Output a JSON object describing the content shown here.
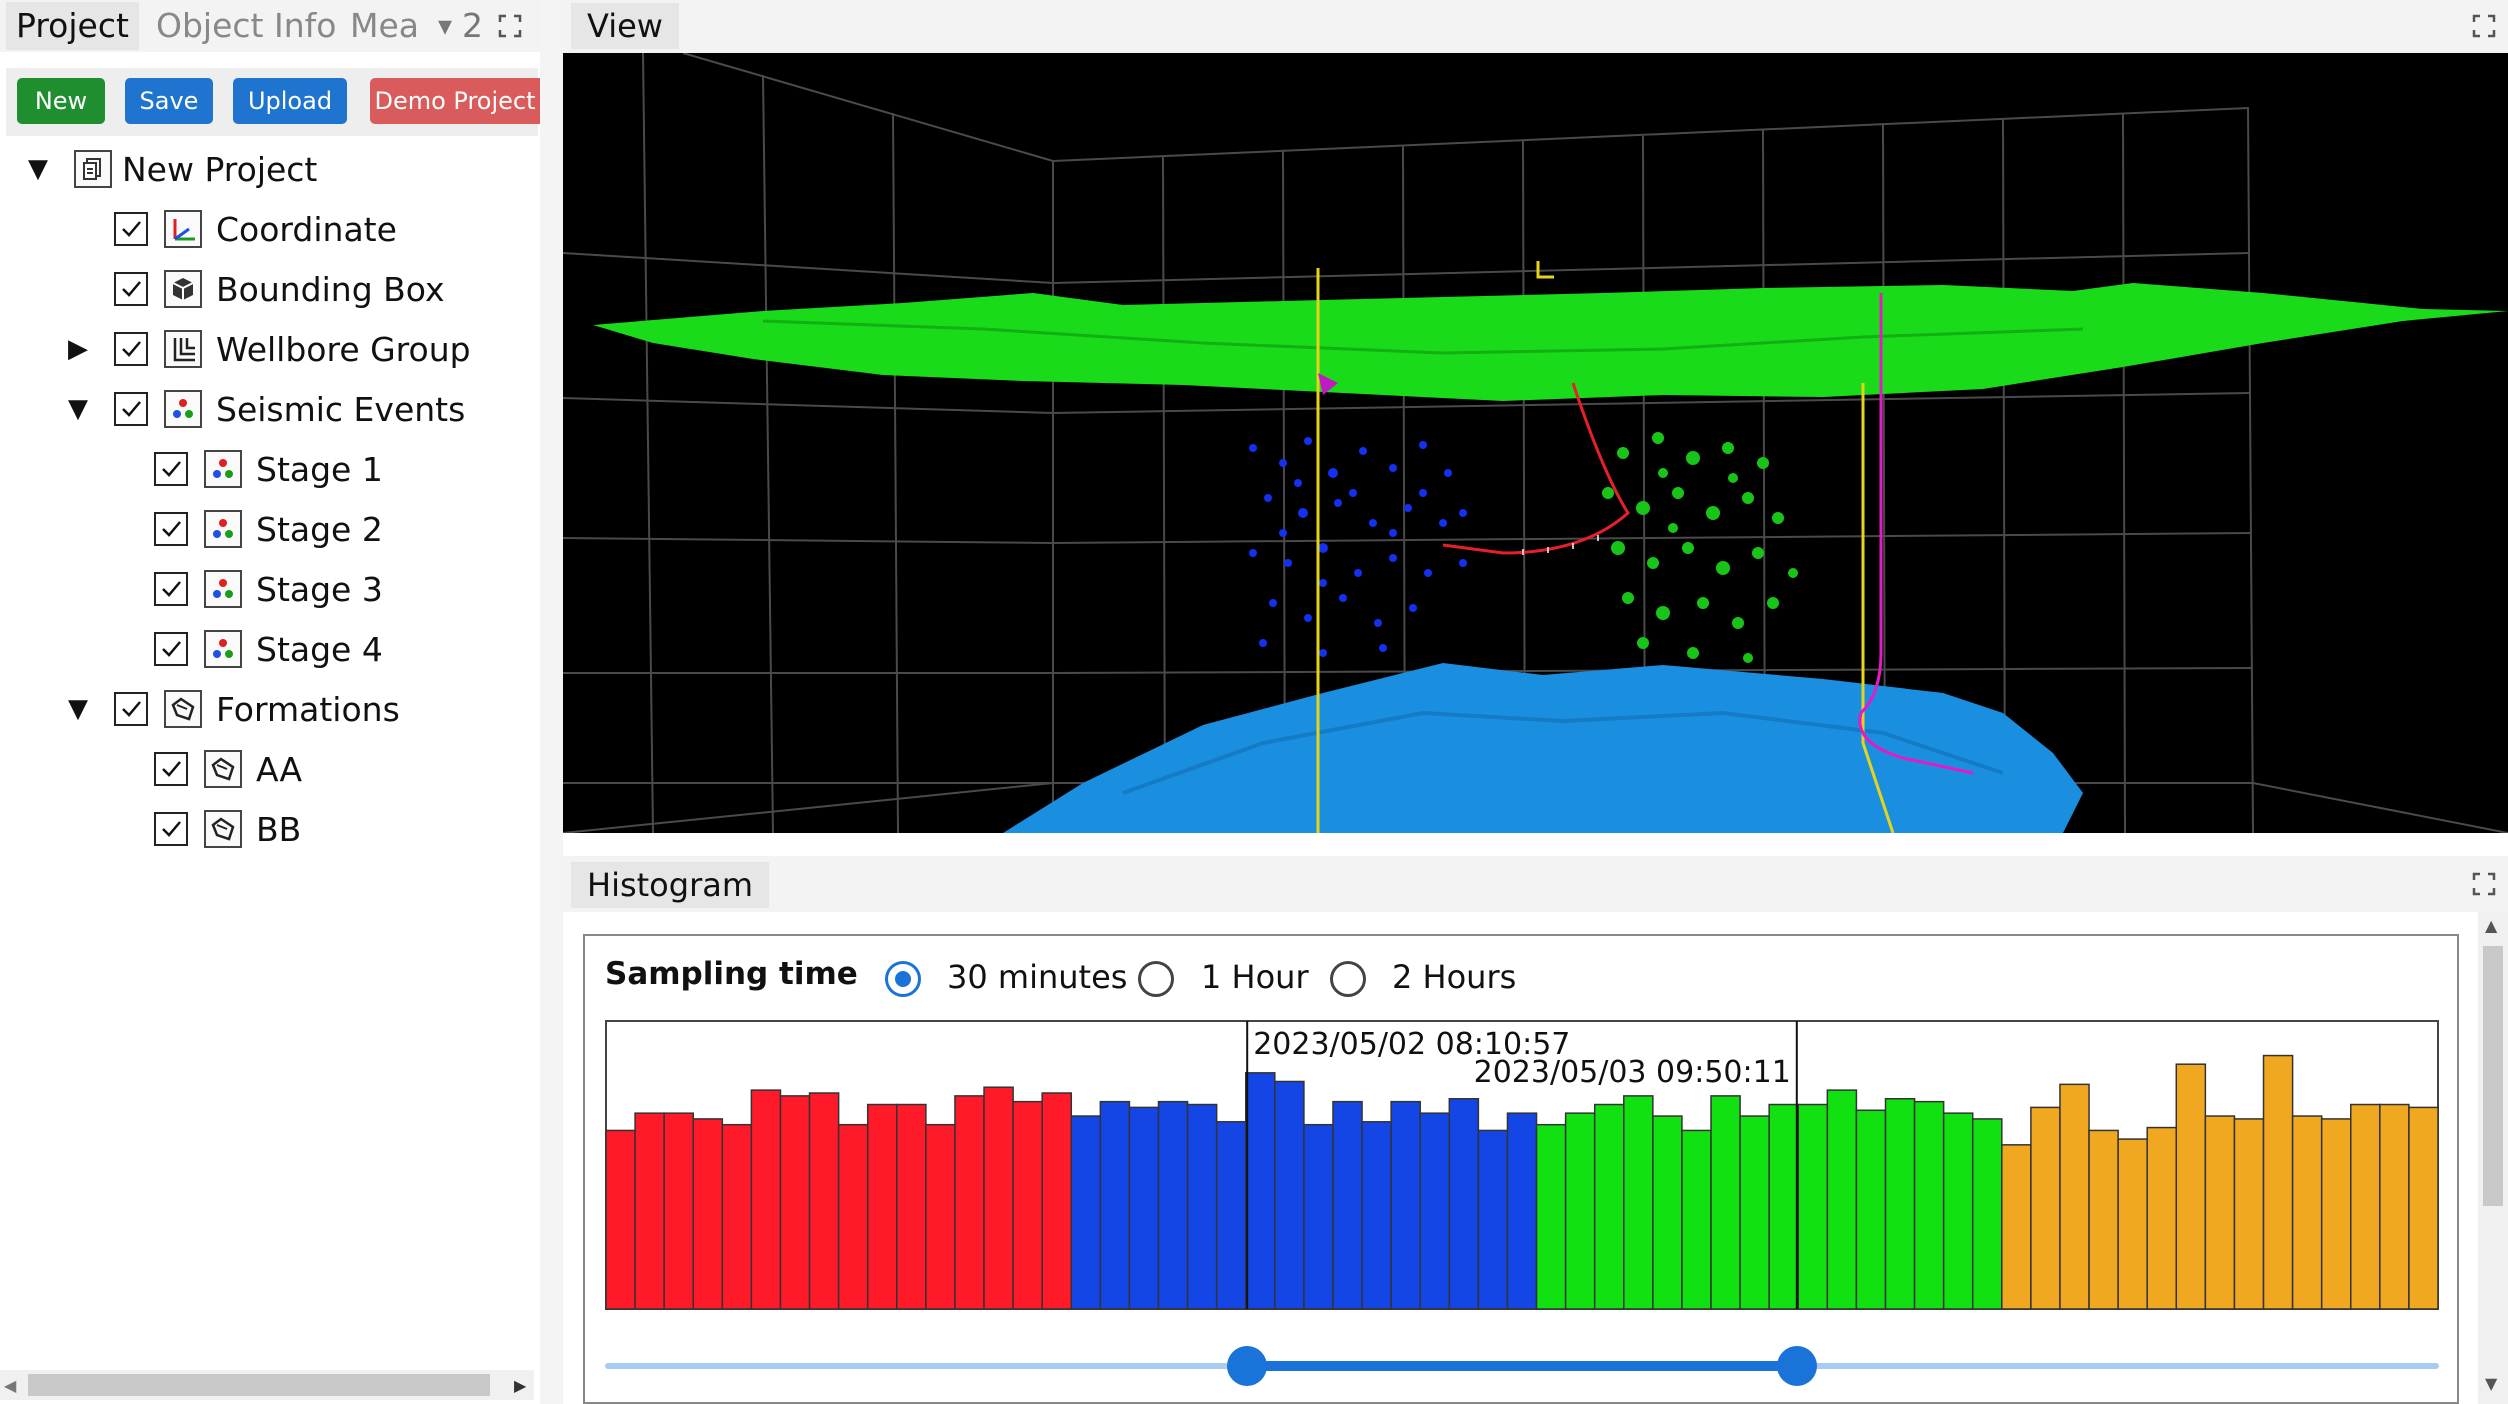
{
  "left_tabs": [
    "Project",
    "Object Info",
    "Mea"
  ],
  "overflow_count": "2",
  "toolbar": {
    "new": "New",
    "save": "Save",
    "upload": "Upload",
    "demo": "Demo Project"
  },
  "tree": {
    "root": "New Project",
    "items": [
      "Coordinate",
      "Bounding Box",
      "Wellbore Group",
      "Seismic Events",
      "Stage 1",
      "Stage 2",
      "Stage 3",
      "Stage 4",
      "Formations",
      "AA",
      "BB"
    ]
  },
  "view_tab": "View",
  "histogram_tab": "Histogram",
  "histogram": {
    "sampling_label": "Sampling time",
    "options": [
      "30 minutes",
      "1 Hour",
      "2 Hours"
    ],
    "selected": "30 minutes",
    "range_start": "2023/05/02 08:10:57",
    "range_end": "2023/05/03 09:50:11",
    "range_fraction": [
      0.35,
      0.65
    ],
    "colors": {
      "stage1": "#ff1a2a",
      "stage2": "#1446e6",
      "stage3": "#11e011",
      "stage4": "#f0a820",
      "slider": "#1a73d9"
    }
  },
  "chart_data": {
    "type": "bar",
    "ylim": [
      0,
      100
    ],
    "series": [
      {
        "values": [
          62,
          68,
          68,
          66,
          64,
          76,
          74,
          75,
          64,
          71,
          71,
          64,
          74,
          77,
          72,
          75
        ]
      },
      {
        "values": [
          67,
          72,
          70,
          72,
          71,
          65,
          82,
          79,
          64,
          72,
          65,
          72,
          68,
          73,
          62,
          68
        ]
      },
      {
        "values": [
          64,
          68,
          71,
          74,
          67,
          62,
          74,
          67,
          71,
          71,
          76,
          69,
          73,
          72,
          68,
          66
        ]
      },
      {
        "values": [
          57,
          70,
          78,
          62,
          59,
          63,
          85,
          67,
          66,
          88,
          67,
          66,
          71,
          71,
          70
        ]
      }
    ]
  }
}
